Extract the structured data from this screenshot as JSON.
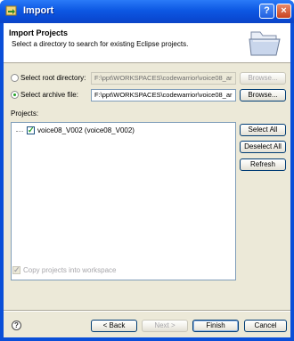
{
  "window": {
    "title": "Import"
  },
  "header": {
    "title": "Import Projects",
    "description": "Select a directory to search for existing Eclipse projects."
  },
  "source": {
    "root_directory_label": "Select root directory:",
    "root_directory_value": "F:\\ppt\\WORKSPACES\\codewarrior\\voice08_ar",
    "root_directory_selected": false,
    "archive_file_label": "Select archive file:",
    "archive_file_value": "F:\\ppt\\WORKSPACES\\codewarrior\\voice08_ar",
    "archive_file_selected": true,
    "browse_label": "Browse..."
  },
  "projects": {
    "label": "Projects:",
    "items": [
      {
        "label": "voice08_V002 (voice08_V002)",
        "checked": true
      }
    ],
    "select_all_label": "Select All",
    "deselect_all_label": "Deselect All",
    "refresh_label": "Refresh"
  },
  "options": {
    "copy_into_workspace_label": "Copy projects into workspace",
    "copy_into_workspace_checked": true
  },
  "footer": {
    "help_symbol": "?",
    "back_label": "< Back",
    "next_label": "Next >",
    "finish_label": "Finish",
    "cancel_label": "Cancel"
  },
  "icons": {
    "title_icon": "import-wizard-icon",
    "banner_icon": "open-folder-icon",
    "help_icon": "help-icon"
  }
}
